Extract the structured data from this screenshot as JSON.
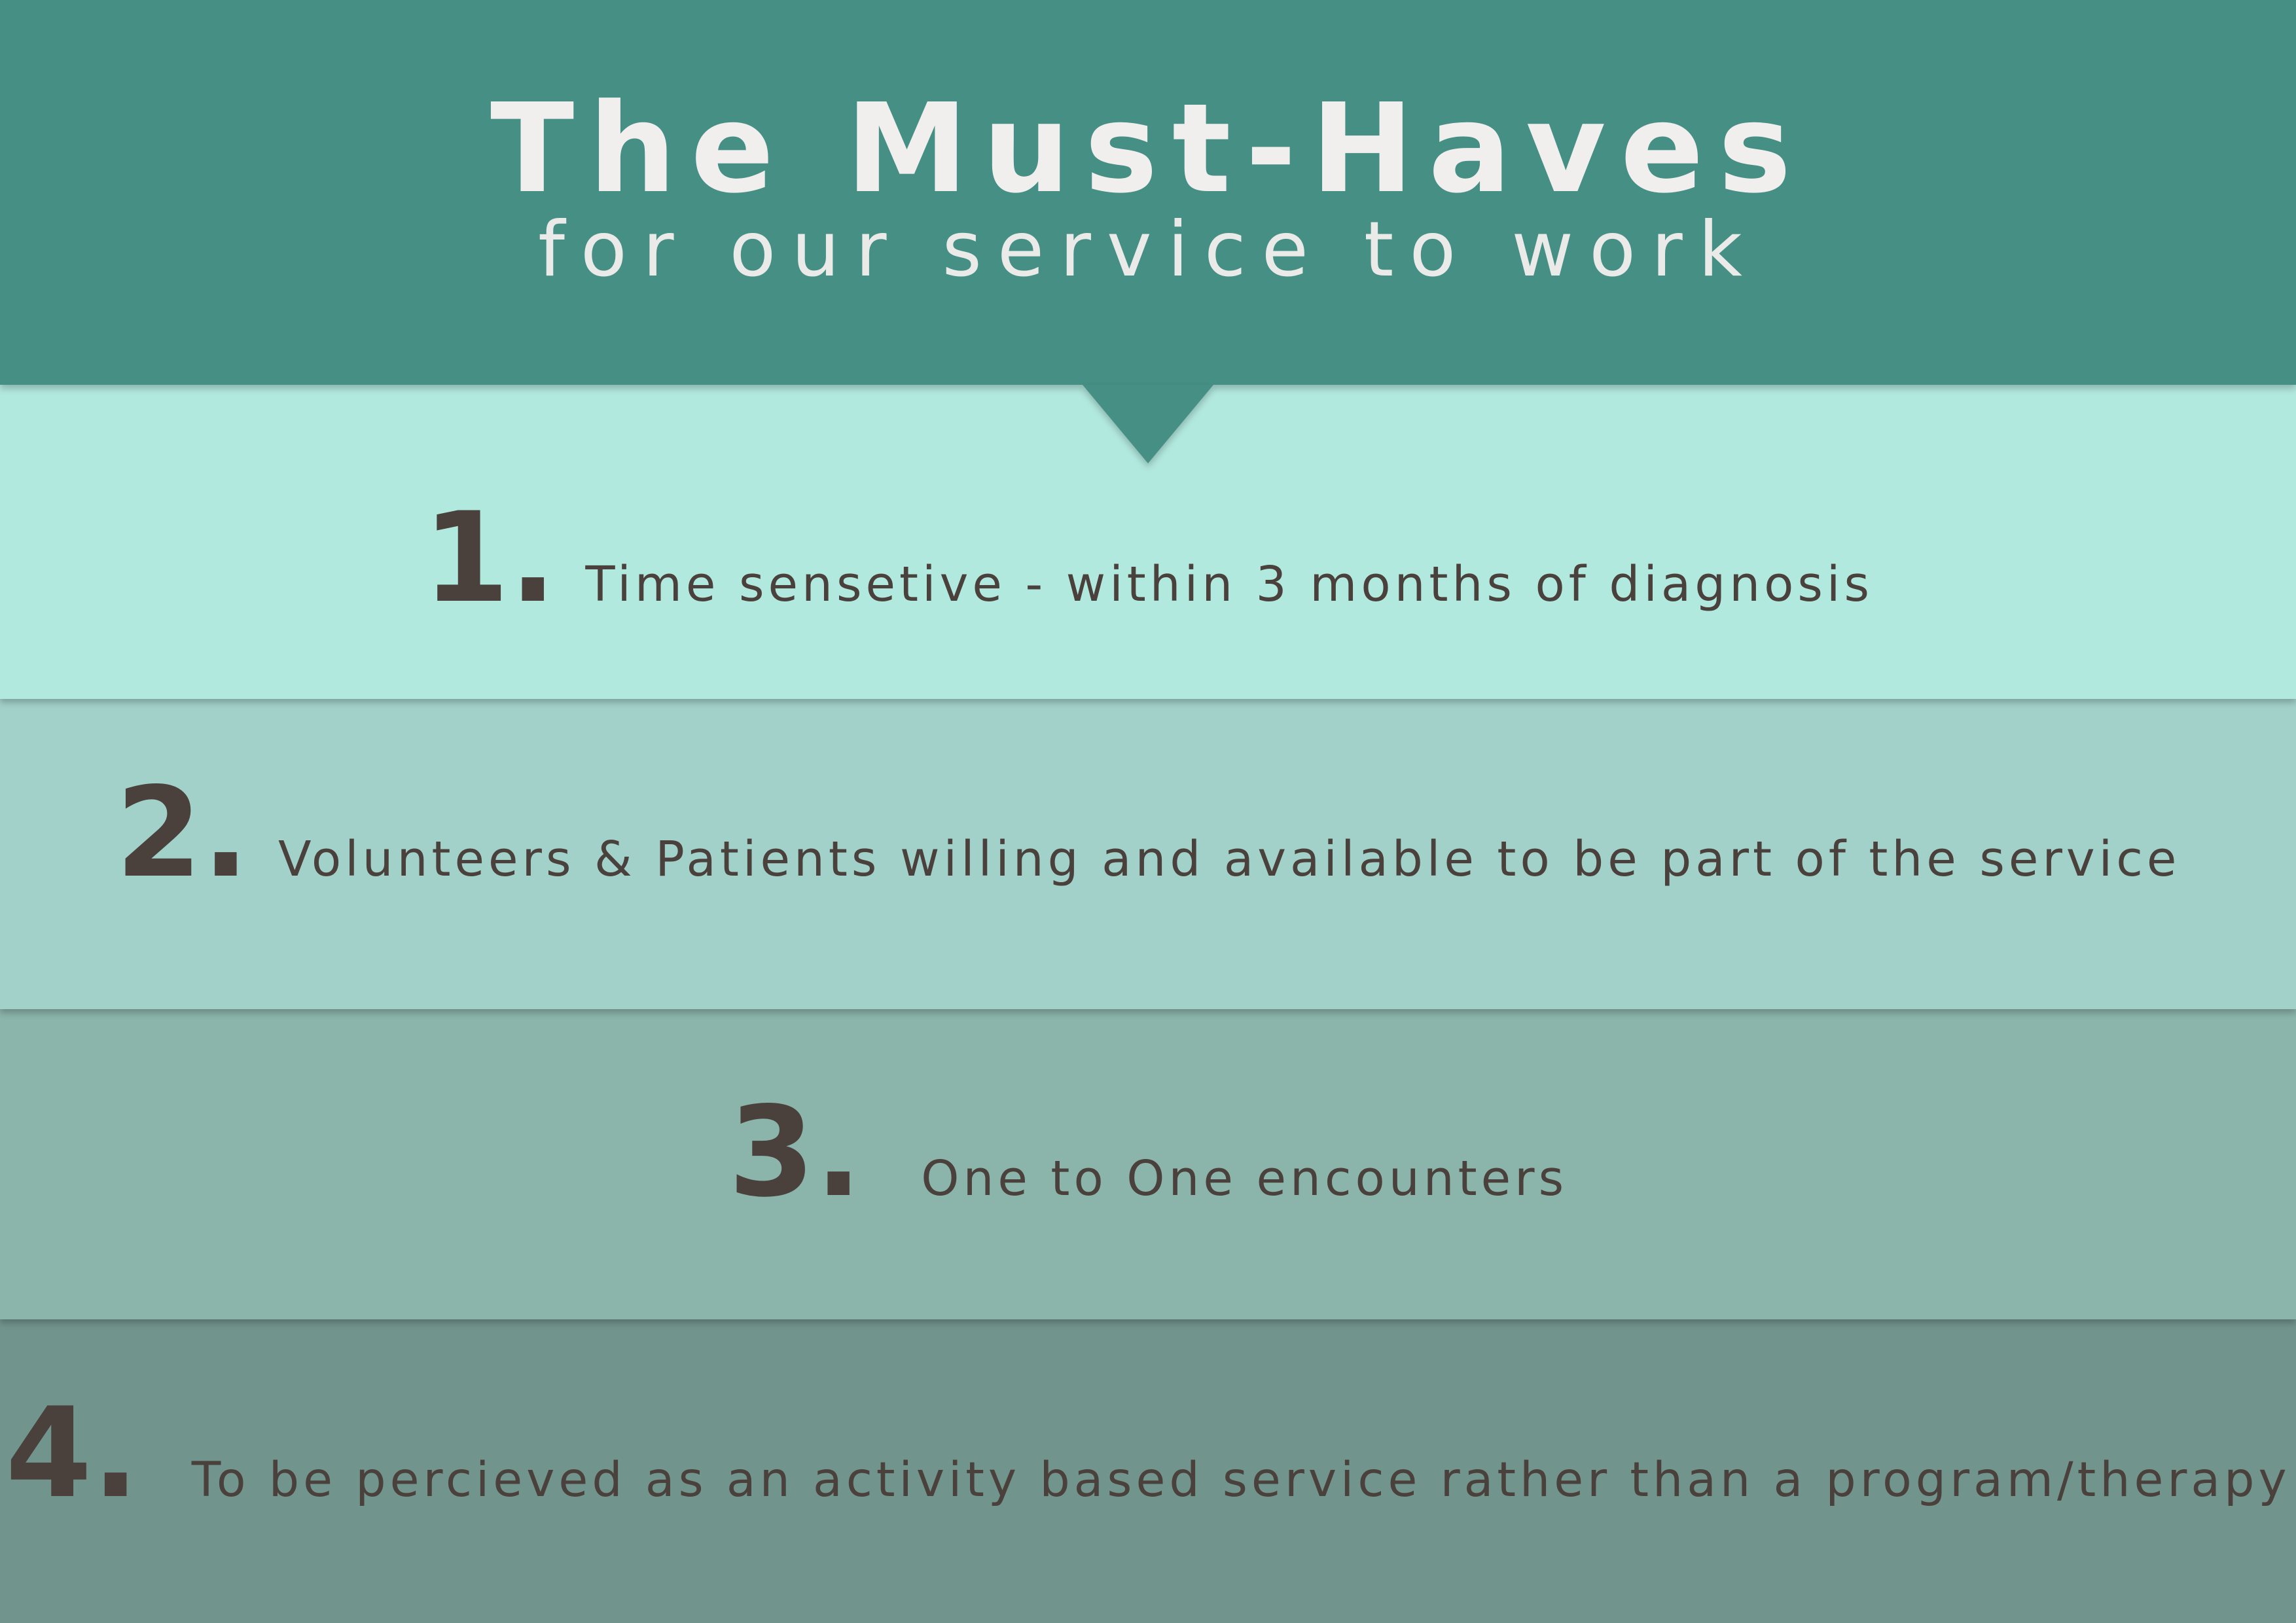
{
  "header": {
    "title": "The Must-Haves",
    "subtitle": "for our service to work"
  },
  "items": [
    {
      "number": "1.",
      "text": "Time sensetive - within 3 months of diagnosis"
    },
    {
      "number": "2.",
      "text": "Volunteers & Patients willing and available to be part of the service"
    },
    {
      "number": "3.",
      "text": "One to One encounters"
    },
    {
      "number": "4.",
      "text": "To be percieved as an activity based service rather than a program/therapy"
    }
  ],
  "colors": {
    "header": "#468f84",
    "row_1": "#b2e9df",
    "row_2": "#a2d1ca",
    "row_3": "#8bb4ab",
    "row_4": "#71948c",
    "title_text": "#f1efee",
    "item_text": "#4a403c"
  }
}
